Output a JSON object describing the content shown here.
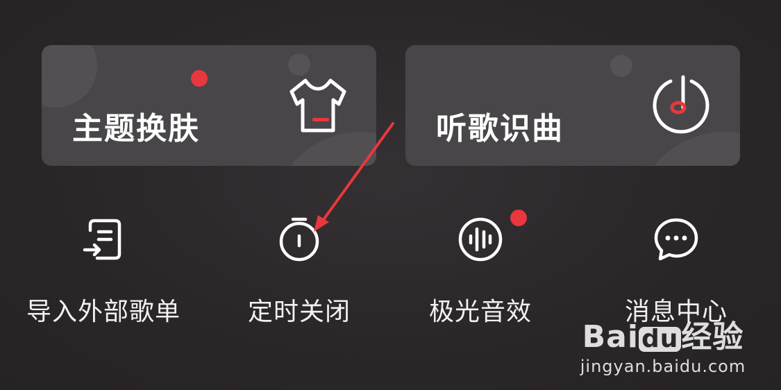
{
  "cards": [
    {
      "title": "主题换肤",
      "icon": "tshirt-icon",
      "badge": true
    },
    {
      "title": "听歌识曲",
      "icon": "music-recognition-icon",
      "badge": false
    }
  ],
  "shortcuts": [
    {
      "label": "导入外部歌单",
      "icon": "import-playlist-icon",
      "badge": false
    },
    {
      "label": "定时关闭",
      "icon": "timer-icon",
      "badge": false
    },
    {
      "label": "极光音效",
      "icon": "sound-wave-icon",
      "badge": true
    },
    {
      "label": "消息中心",
      "icon": "chat-bubble-icon",
      "badge": false
    }
  ],
  "watermark": {
    "logo_prefix": "Bai",
    "logo_du": "du",
    "logo_suffix": "经验",
    "url": "jingyan.baidu.com"
  },
  "colors": {
    "background": "#2b2729",
    "card": "#49464a",
    "badge": "#e8383d",
    "accent": "#e8383d"
  }
}
